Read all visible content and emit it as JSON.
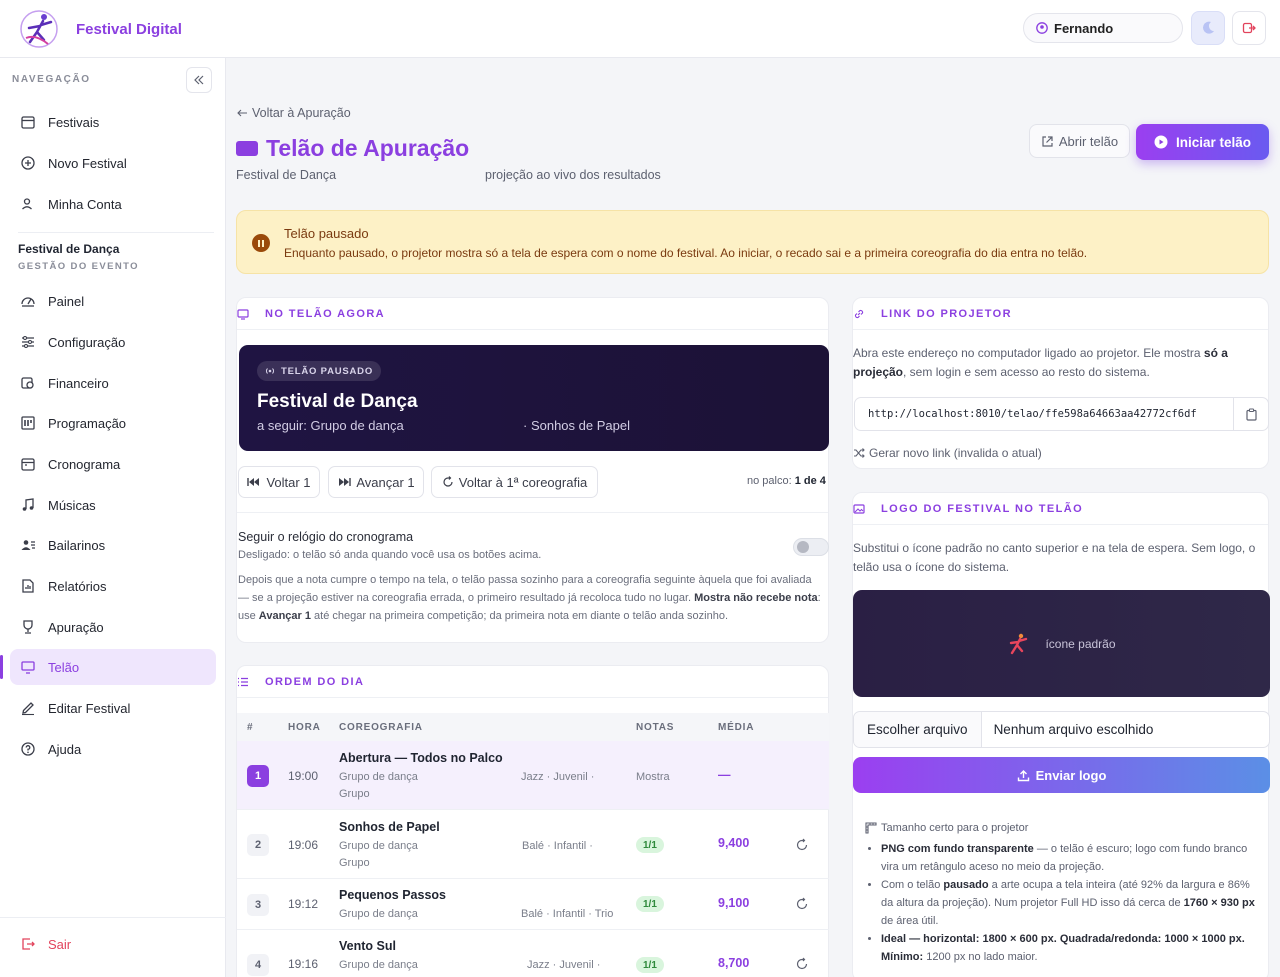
{
  "brand": {
    "name": "Festival Digital"
  },
  "user": {
    "name": "Fernando"
  },
  "sidebar": {
    "nav_title": "NAVEGAÇÃO",
    "main_items": [
      {
        "label": "Festivais",
        "icon": "calendar-icon"
      },
      {
        "label": "Novo Festival",
        "icon": "plus-circle-icon"
      },
      {
        "label": "Minha Conta",
        "icon": "user-icon"
      }
    ],
    "event_name": "Festival de Dança",
    "event_sub": "GESTÃO DO EVENTO",
    "event_items": [
      {
        "label": "Painel",
        "icon": "dashboard-icon"
      },
      {
        "label": "Configuração",
        "icon": "sliders-icon"
      },
      {
        "label": "Financeiro",
        "icon": "money-icon"
      },
      {
        "label": "Programação",
        "icon": "schedule-icon"
      },
      {
        "label": "Cronograma",
        "icon": "calendar-icon"
      },
      {
        "label": "Músicas",
        "icon": "music-icon"
      },
      {
        "label": "Bailarinos",
        "icon": "users-icon"
      },
      {
        "label": "Relatórios",
        "icon": "report-icon"
      },
      {
        "label": "Apuração",
        "icon": "trophy-icon"
      },
      {
        "label": "Telão",
        "icon": "monitor-icon",
        "active": true
      },
      {
        "label": "Editar Festival",
        "icon": "edit-icon"
      },
      {
        "label": "Ajuda",
        "icon": "help-icon"
      }
    ],
    "logout": "Sair"
  },
  "header": {
    "back": "Voltar à Apuração",
    "title": "Telão de Apuração",
    "festival": "Festival de Dança",
    "subtitle": "projeção ao vivo dos resultados",
    "open_btn": "Abrir telão",
    "start_btn": "Iniciar telão"
  },
  "banner": {
    "title": "Telão pausado",
    "text": "Enquanto pausado, o projetor mostra só a tela de espera com o nome do festival. Ao iniciar, o recado sai e a primeira coreografia do dia entra no telão."
  },
  "now": {
    "heading": "NO TELÃO AGORA",
    "badge": "TELÃO PAUSADO",
    "stage_title": "Festival de Dança",
    "next": "a seguir: Grupo de dança",
    "next2": "· Sonhos de Papel",
    "btn_back": "Voltar 1",
    "btn_forward": "Avançar 1",
    "btn_first": "Voltar à 1ª coreografia",
    "onstage_label": "no palco:",
    "onstage_value": "1 de 4",
    "follow_title": "Seguir o relógio do cronograma",
    "follow_sub": "Desligado: o telão só anda quando você usa os botões acima.",
    "follow_toggle_on": false,
    "follow_body_1": "Depois que a nota cumpre o tempo na tela, o telão passa sozinho para a coreografia seguinte àquela que foi avaliada — se a projeção estiver na coreografia errada, o primeiro resultado já recoloca tudo no lugar. ",
    "follow_body_b1": "Mostra não recebe nota",
    "follow_body_2": ": use ",
    "follow_body_b2": "Avançar 1",
    "follow_body_3": " até chegar na primeira competição; da primeira nota em diante o telão anda sozinho."
  },
  "order": {
    "heading": "ORDEM DO DIA",
    "columns": [
      "#",
      "HORA",
      "COREOGRAFIA",
      "NOTAS",
      "MÉDIA"
    ],
    "rows": [
      {
        "n": "1",
        "time": "19:00",
        "name": "Abertura — Todos no Palco",
        "group": "Grupo de dança",
        "group2": "Grupo",
        "cat": "Jazz · Juvenil ·",
        "notes": "Mostra",
        "media": "—",
        "current": true
      },
      {
        "n": "2",
        "time": "19:06",
        "name": "Sonhos de Papel",
        "group": "Grupo de dança",
        "group2": "Grupo",
        "cat": "Balé · Infantil ·",
        "notes": "1/1",
        "media": "9,400"
      },
      {
        "n": "3",
        "time": "19:12",
        "name": "Pequenos Passos",
        "group": "Grupo de dança",
        "group2": "",
        "cat": "Balé · Infantil · Trio",
        "notes": "1/1",
        "media": "9,100"
      },
      {
        "n": "4",
        "time": "19:16",
        "name": "Vento Sul",
        "group": "Grupo de dança",
        "group2": "",
        "cat": "Jazz · Juvenil ·",
        "notes": "1/1",
        "media": "8,700"
      }
    ]
  },
  "link": {
    "heading": "LINK DO PROJETOR",
    "text_1": "Abra este endereço no computador ligado ao projetor. Ele mostra ",
    "text_b": "só a projeção",
    "text_2": ", sem login e sem acesso ao resto do sistema.",
    "url": "http://localhost:8010/telao/ffe598a64663aa42772cf6df",
    "regen": "Gerar novo link (invalida o atual)"
  },
  "logo": {
    "heading": "LOGO DO FESTIVAL NO TELÃO",
    "text": "Substitui o ícone padrão no canto superior e na tela de espera. Sem logo, o telão usa o ícone do sistema.",
    "preview_label": "ícone padrão",
    "file_btn": "Escolher arquivo",
    "file_none": "Nenhum arquivo escolhido",
    "send_btn": "Enviar logo",
    "tips_title": "Tamanho certo para o projetor",
    "tip1_b": "PNG com fundo transparente",
    "tip1": " — o telão é escuro; logo com fundo branco vira um retângulo aceso no meio da projeção.",
    "tip2_a": "Com o telão ",
    "tip2_b": "pausado",
    "tip2_c": " a arte ocupa a tela inteira (até 92% da largura e 86% da altura da projeção). Num projetor Full HD isso dá cerca de ",
    "tip2_d": "1760 × 930 px",
    "tip2_e": " de área útil.",
    "tip3_b": "Ideal — horizontal: 1800 × 600 px. Quadrada/redonda: 1000 × 1000 px. Mínimo:",
    "tip3": " 1200 px no lado maior."
  },
  "colors": {
    "accent": "#8b3fe0",
    "banner_bg": "#fdf1c6",
    "stage_bg": "#1f1442",
    "success": "#2f8a3c"
  }
}
